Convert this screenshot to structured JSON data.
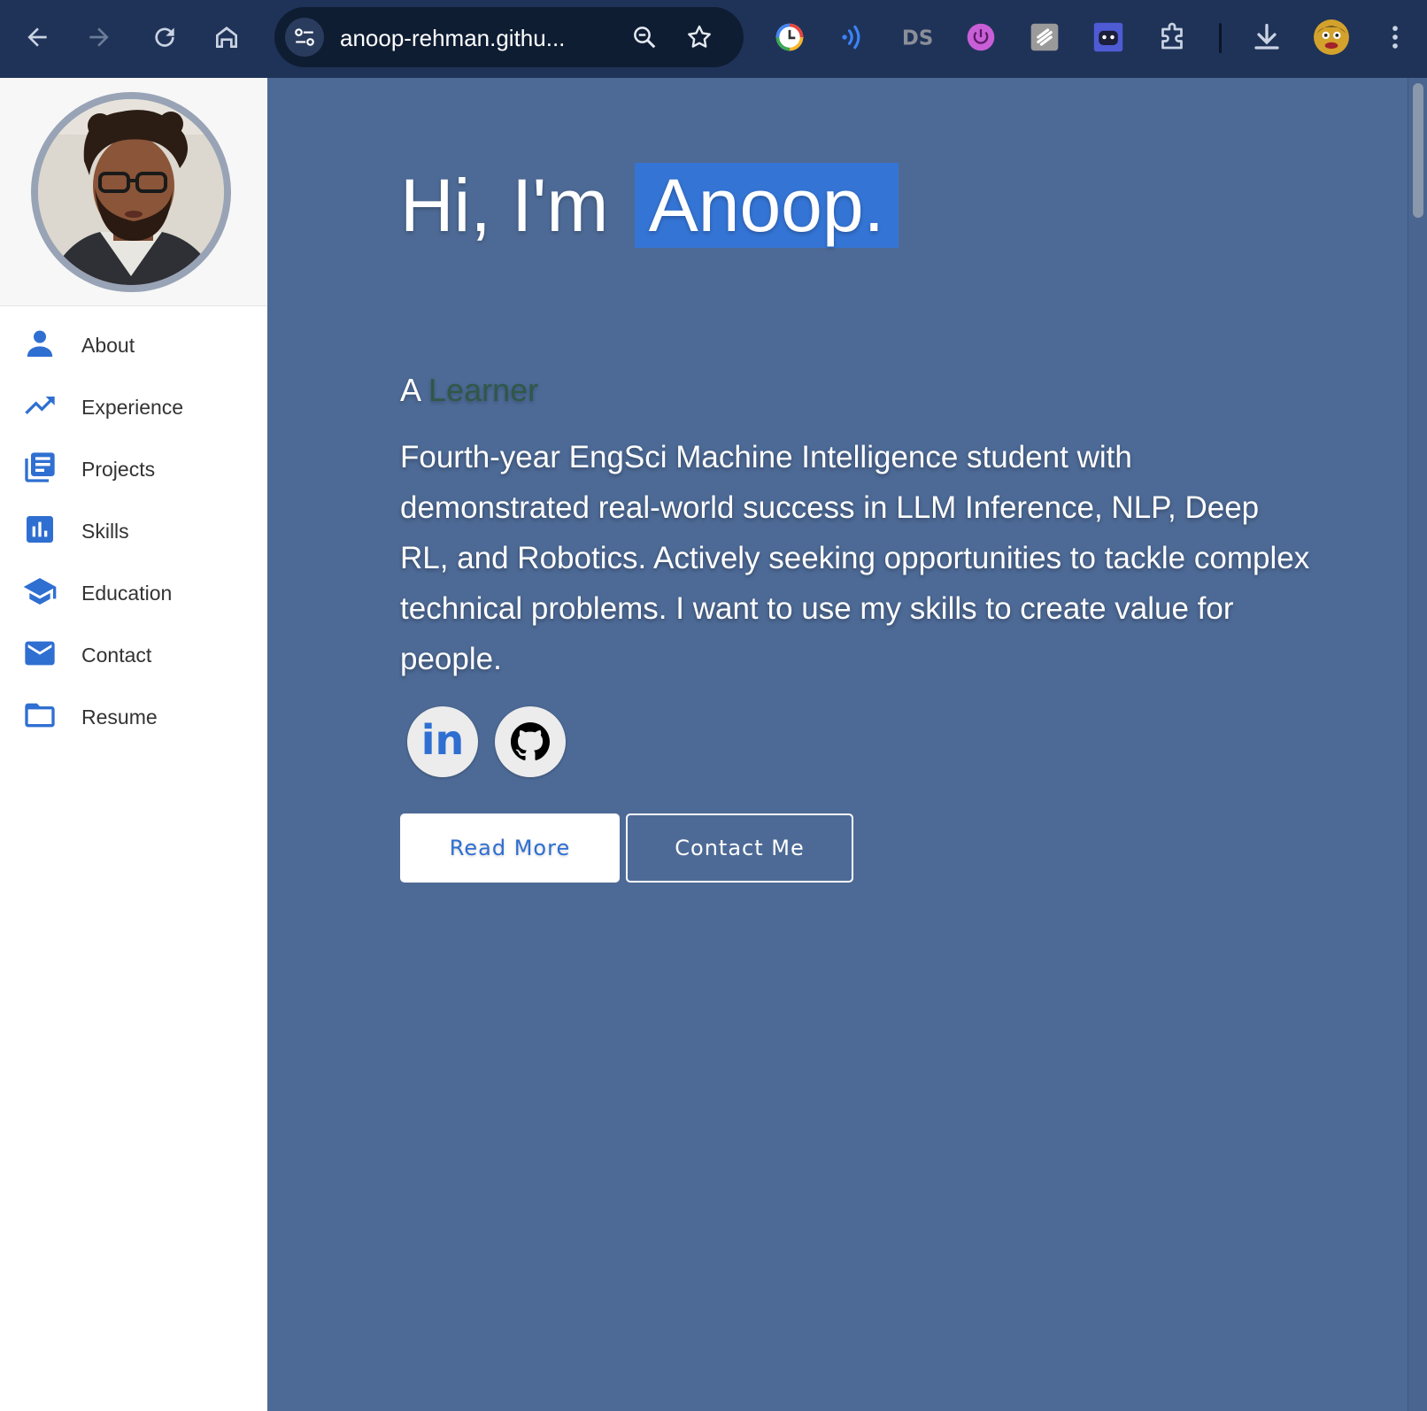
{
  "browser": {
    "url": "anoop-rehman.githu...",
    "colors": {
      "chrome_bg": "#1f3358",
      "omnibox_bg": "#0f1d33"
    }
  },
  "sidebar": {
    "items": [
      {
        "label": "About",
        "icon": "person-icon"
      },
      {
        "label": "Experience",
        "icon": "trending-up-icon"
      },
      {
        "label": "Projects",
        "icon": "library-books-icon"
      },
      {
        "label": "Skills",
        "icon": "bar-chart-icon"
      },
      {
        "label": "Education",
        "icon": "school-icon"
      },
      {
        "label": "Contact",
        "icon": "mail-icon"
      },
      {
        "label": "Resume",
        "icon": "folder-icon"
      }
    ]
  },
  "hero": {
    "greeting": "Hi, I'm",
    "name": "Anoop.",
    "subtitle_prefix": "A",
    "subtitle_role": "Learner",
    "bio": "Fourth-year EngSci Machine Intelligence student with demonstrated real-world success in LLM Inference, NLP, Deep RL, and Robotics. Actively seeking opportunities to tackle complex technical problems. I want to use my skills to create value for people.",
    "social": [
      {
        "name": "linkedin-icon",
        "text": "in"
      },
      {
        "name": "github-icon"
      }
    ],
    "buttons": {
      "read_more": "Read More",
      "contact_me": "Contact Me"
    }
  },
  "colors": {
    "main_bg": "#4d6a96",
    "accent": "#3474d4",
    "icon_blue": "#2f6fd1",
    "role_text": "#2f5848"
  }
}
